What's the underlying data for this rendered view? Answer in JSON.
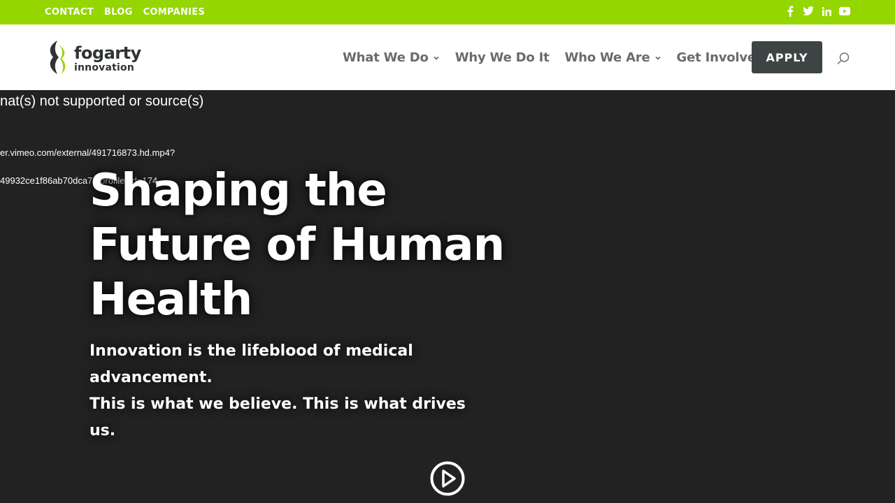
{
  "topbar": {
    "links": [
      "CONTACT",
      "BLOG",
      "COMPANIES"
    ],
    "social_icons": [
      "facebook-icon",
      "twitter-icon",
      "linkedin-icon",
      "youtube-icon"
    ],
    "background": "#95d600"
  },
  "header": {
    "logo": {
      "name": "fogarty",
      "sub": "innovation"
    },
    "nav": [
      {
        "label": "What We Do",
        "has_dropdown": true
      },
      {
        "label": "Why We Do It",
        "has_dropdown": false
      },
      {
        "label": "Who We Are",
        "has_dropdown": true
      },
      {
        "label": "Get Involved",
        "has_dropdown": true
      }
    ],
    "apply_label": "APPLY",
    "search_icon": "search-icon",
    "apply_color": "#3d4444"
  },
  "hero": {
    "video_error_lines": [
      "nat(s) not supported or source(s)",
      "er.vimeo.com/external/491716873.hd.mp4?",
      "49932ce1f86ab70dca73 profile_id=174"
    ],
    "title": "Shaping the Future of Human Health",
    "subtitle_lines": [
      "Innovation is the lifeblood of medical advancement.",
      "This is what we believe. This is what drives us."
    ],
    "play_icon": "play-circle-icon",
    "background": "#222222"
  }
}
